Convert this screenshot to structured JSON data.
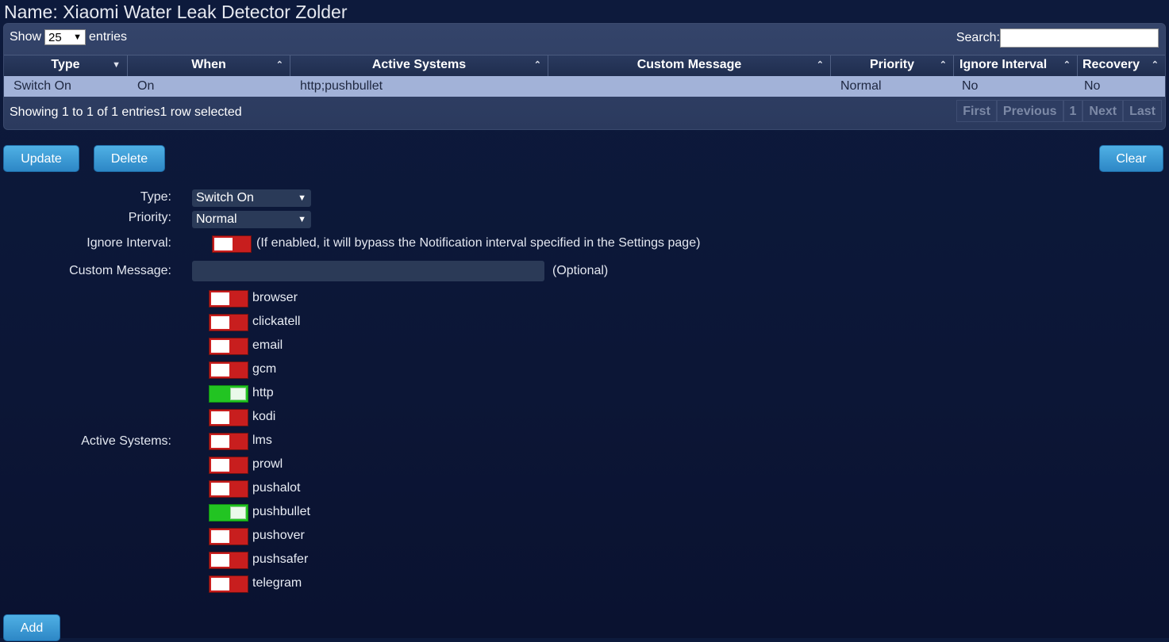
{
  "page": {
    "title": "Name: Xiaomi Water Leak Detector Zolder"
  },
  "grid": {
    "show_label": "Show",
    "entries_label": "entries",
    "page_size": "25",
    "search_label": "Search:",
    "search_value": "",
    "columns": [
      "Type",
      "When",
      "Active Systems",
      "Custom Message",
      "Priority",
      "Ignore Interval",
      "Recovery"
    ],
    "rows": [
      [
        "Switch On",
        "On",
        "http;pushbullet",
        "",
        "Normal",
        "No",
        "No"
      ]
    ],
    "info": "Showing 1 to 1 of 1 entries1 row selected",
    "pager": [
      "First",
      "Previous",
      "1",
      "Next",
      "Last"
    ]
  },
  "actions": {
    "update": "Update",
    "delete": "Delete",
    "clear": "Clear",
    "add": "Add"
  },
  "form": {
    "type_label": "Type:",
    "type_value": "Switch On",
    "priority_label": "Priority:",
    "priority_value": "Normal",
    "ignore_label": "Ignore Interval:",
    "ignore_hint": "(If enabled, it will bypass the Notification interval specified in the Settings page)",
    "ignore_enabled": false,
    "message_label": "Custom Message:",
    "message_value": "",
    "message_hint": "(Optional)",
    "systems_label": "Active Systems:",
    "systems": [
      {
        "name": "browser",
        "enabled": false
      },
      {
        "name": "clickatell",
        "enabled": false
      },
      {
        "name": "email",
        "enabled": false
      },
      {
        "name": "gcm",
        "enabled": false
      },
      {
        "name": "http",
        "enabled": true
      },
      {
        "name": "kodi",
        "enabled": false
      },
      {
        "name": "lms",
        "enabled": false
      },
      {
        "name": "prowl",
        "enabled": false
      },
      {
        "name": "pushalot",
        "enabled": false
      },
      {
        "name": "pushbullet",
        "enabled": true
      },
      {
        "name": "pushover",
        "enabled": false
      },
      {
        "name": "pushsafer",
        "enabled": false
      },
      {
        "name": "telegram",
        "enabled": false
      }
    ]
  },
  "colors": {
    "toggle_off": "#c81e1e",
    "toggle_on": "#22c422",
    "button": "#2d87c6",
    "selected_row": "#a2b2d8"
  }
}
